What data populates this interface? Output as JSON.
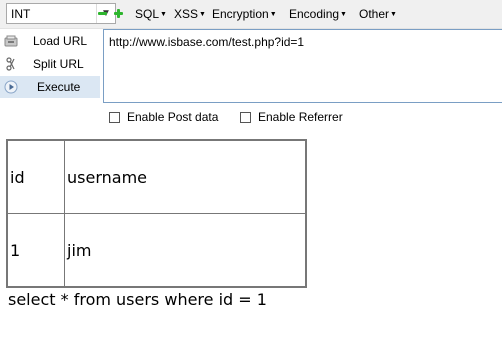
{
  "toolbar": {
    "select_value": "INT",
    "menus": [
      {
        "label": "SQL"
      },
      {
        "label": "XSS"
      },
      {
        "label": "Encryption"
      },
      {
        "label": "Encoding"
      },
      {
        "label": "Other"
      }
    ]
  },
  "actions": [
    {
      "label": "Load URL",
      "icon": "load-url-icon"
    },
    {
      "label": "Split URL",
      "icon": "split-url-icon"
    },
    {
      "label": "Execute",
      "icon": "execute-icon"
    }
  ],
  "url": "http://www.isbase.com/test.php?id=1",
  "options": {
    "post_data": "Enable Post data",
    "referrer": "Enable Referrer"
  },
  "result": {
    "headers": [
      "id",
      "username"
    ],
    "rows": [
      [
        "1",
        "jim"
      ]
    ]
  },
  "query": "select * from users where id = 1",
  "colors": {
    "accent": "#7a9ec4",
    "execute_bg": "#dbe7f3",
    "green_icon": "#2db52d"
  }
}
